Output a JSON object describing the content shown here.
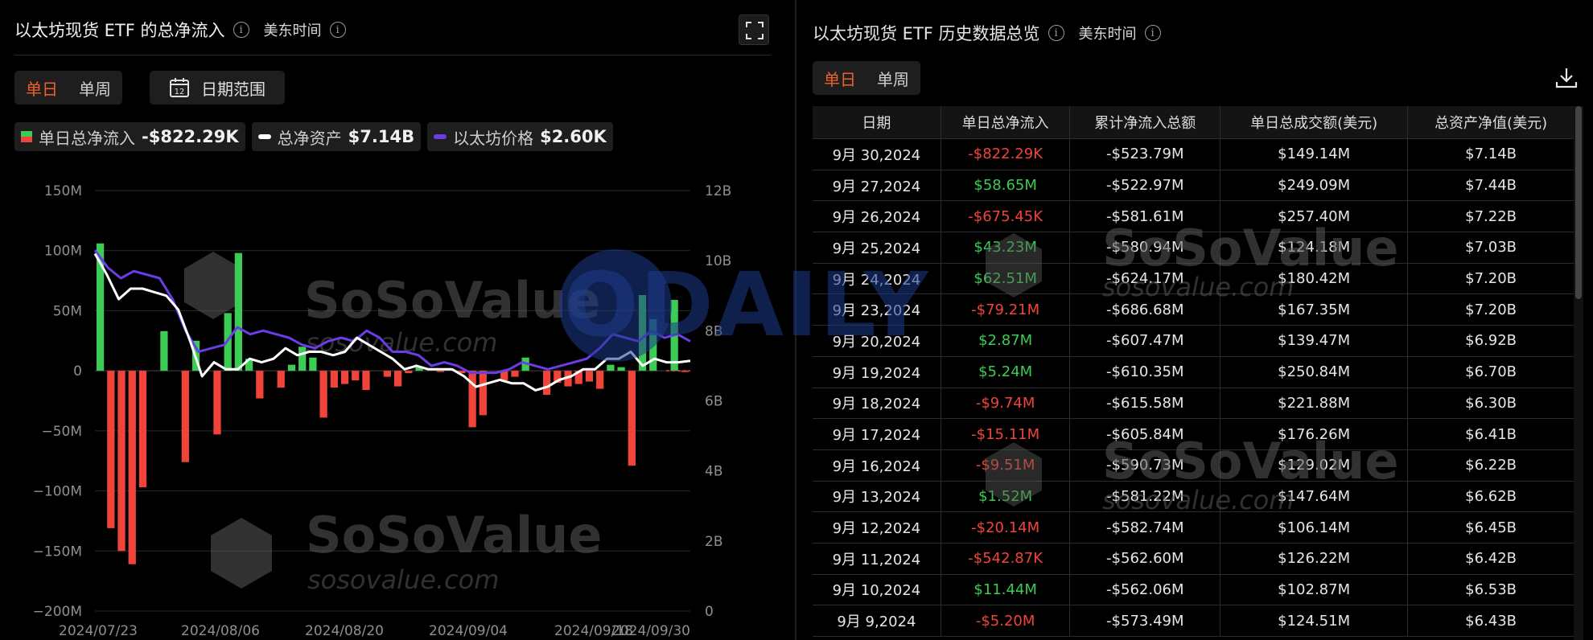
{
  "left": {
    "title": "以太坊现货 ETF 的总净流入",
    "timezone": "美东时间",
    "tabs": [
      "单日",
      "单周"
    ],
    "date_range_label": "日期范围",
    "date_range_icon_day": "12",
    "legend": [
      {
        "label": "单日总净流入",
        "value": "-$822.29K"
      },
      {
        "label": "总净资产",
        "value": "$7.14B"
      },
      {
        "label": "以太坊价格",
        "value": "$2.60K"
      }
    ],
    "watermark": {
      "brand": "SoSoValue",
      "domain": "sosovalue.com"
    }
  },
  "colors": {
    "positive": "#3ccb54",
    "negative": "#f0443a",
    "total_assets": "#ffffff",
    "eth_price": "#6a3de8",
    "accent": "#f0602a"
  },
  "chart_data": {
    "type": "bar",
    "title": "以太坊现货 ETF 的总净流入",
    "x_ticks": [
      "2024/07/23",
      "2024/08/06",
      "2024/08/20",
      "2024/09/04",
      "2024/09/18",
      "2024/09/30"
    ],
    "y_left_ticks": [
      "150M",
      "100M",
      "50M",
      "0",
      "−50M",
      "−100M",
      "−150M",
      "−200M"
    ],
    "y_left_lim": [
      -200,
      150
    ],
    "y_right_ticks": [
      "12B",
      "10B",
      "8B",
      "6B",
      "4B",
      "2B",
      "0"
    ],
    "y_right_lim": [
      0,
      12
    ],
    "series": [
      {
        "name": "单日总净流入",
        "type": "bar",
        "unit": "M",
        "values": [
          106,
          -131,
          -150,
          -161,
          -97,
          0,
          33,
          0,
          -76,
          25,
          0,
          -53,
          48,
          98,
          10,
          -23,
          0,
          -14,
          5,
          20,
          11,
          -39,
          -14,
          -11,
          -8,
          -16,
          0,
          -5,
          -13,
          -2,
          3,
          0,
          -1,
          0,
          -2,
          -47,
          -37,
          0,
          -8,
          -5,
          11,
          0,
          -20,
          -10,
          -13,
          -11,
          -9,
          -15,
          5,
          3,
          -79,
          63,
          43,
          0,
          59,
          -0.68
        ]
      },
      {
        "name": "总净资产",
        "type": "line",
        "unit": "B",
        "values": [
          10.2,
          9.6,
          8.9,
          9.2,
          9.2,
          9.1,
          9.0,
          8.6,
          7.7,
          6.7,
          7.1,
          6.9,
          6.9,
          7.2,
          7.1,
          7.2,
          7.5,
          7.3,
          7.4,
          7.4,
          7.3,
          7.4,
          7.8,
          7.6,
          7.4,
          7.2,
          6.9,
          7.0,
          6.9,
          6.9,
          6.9,
          6.7,
          6.4,
          6.5,
          6.6,
          6.5,
          6.5,
          6.3,
          6.4,
          6.6,
          6.7,
          6.9,
          6.9,
          7.2,
          7.2,
          7.4,
          7.0,
          7.2,
          7.1,
          7.1,
          7.14
        ]
      },
      {
        "name": "以太坊价格",
        "type": "line",
        "unit": "K",
        "values": [
          10.3,
          9.8,
          9.5,
          9.7,
          9.6,
          9.5,
          8.9,
          8.0,
          7.4,
          7.5,
          7.6,
          8.1,
          7.9,
          8.0,
          7.9,
          7.8,
          7.6,
          7.5,
          7.7,
          7.8,
          7.7,
          8.0,
          7.8,
          7.4,
          7.4,
          7.3,
          7.0,
          7.1,
          7.0,
          6.8,
          6.8,
          6.8,
          6.9,
          7.1,
          7.0,
          6.9,
          7.0,
          7.1,
          7.2,
          7.5,
          7.9,
          7.8,
          7.7,
          8.0,
          7.8,
          7.9,
          7.7
        ]
      }
    ]
  },
  "right": {
    "title": "以太坊现货 ETF 历史数据总览",
    "timezone": "美东时间",
    "tabs": [
      "单日",
      "单周"
    ],
    "columns": [
      "日期",
      "单日总净流入",
      "累计净流入总额",
      "单日总成交额(美元)",
      "总资产净值(美元)"
    ],
    "rows": [
      [
        "9月 30,2024",
        "-$822.29K",
        "-$523.79M",
        "$149.14M",
        "$7.14B"
      ],
      [
        "9月 27,2024",
        "$58.65M",
        "-$522.97M",
        "$249.09M",
        "$7.44B"
      ],
      [
        "9月 26,2024",
        "-$675.45K",
        "-$581.61M",
        "$257.40M",
        "$7.22B"
      ],
      [
        "9月 25,2024",
        "$43.23M",
        "-$580.94M",
        "$124.18M",
        "$7.03B"
      ],
      [
        "9月 24,2024",
        "$62.51M",
        "-$624.17M",
        "$180.42M",
        "$7.20B"
      ],
      [
        "9月 23,2024",
        "-$79.21M",
        "-$686.68M",
        "$167.35M",
        "$7.20B"
      ],
      [
        "9月 20,2024",
        "$2.87M",
        "-$607.47M",
        "$139.47M",
        "$6.92B"
      ],
      [
        "9月 19,2024",
        "$5.24M",
        "-$610.35M",
        "$250.84M",
        "$6.70B"
      ],
      [
        "9月 18,2024",
        "-$9.74M",
        "-$615.58M",
        "$221.88M",
        "$6.30B"
      ],
      [
        "9月 17,2024",
        "-$15.11M",
        "-$605.84M",
        "$176.26M",
        "$6.41B"
      ],
      [
        "9月 16,2024",
        "-$9.51M",
        "-$590.73M",
        "$129.02M",
        "$6.22B"
      ],
      [
        "9月 13,2024",
        "$1.52M",
        "-$581.22M",
        "$147.64M",
        "$6.62B"
      ],
      [
        "9月 12,2024",
        "-$20.14M",
        "-$582.74M",
        "$106.14M",
        "$6.45B"
      ],
      [
        "9月 11,2024",
        "-$542.87K",
        "-$562.60M",
        "$126.22M",
        "$6.42B"
      ],
      [
        "9月 10,2024",
        "$11.44M",
        "-$562.06M",
        "$102.87M",
        "$6.53B"
      ],
      [
        "9月 9,2024",
        "-$5.20M",
        "-$573.49M",
        "$124.51M",
        "$6.43B"
      ]
    ],
    "watermark": {
      "brand": "SoSoValue",
      "domain": "sosovalue.com"
    }
  },
  "overlay_watermark": "ODAILY"
}
